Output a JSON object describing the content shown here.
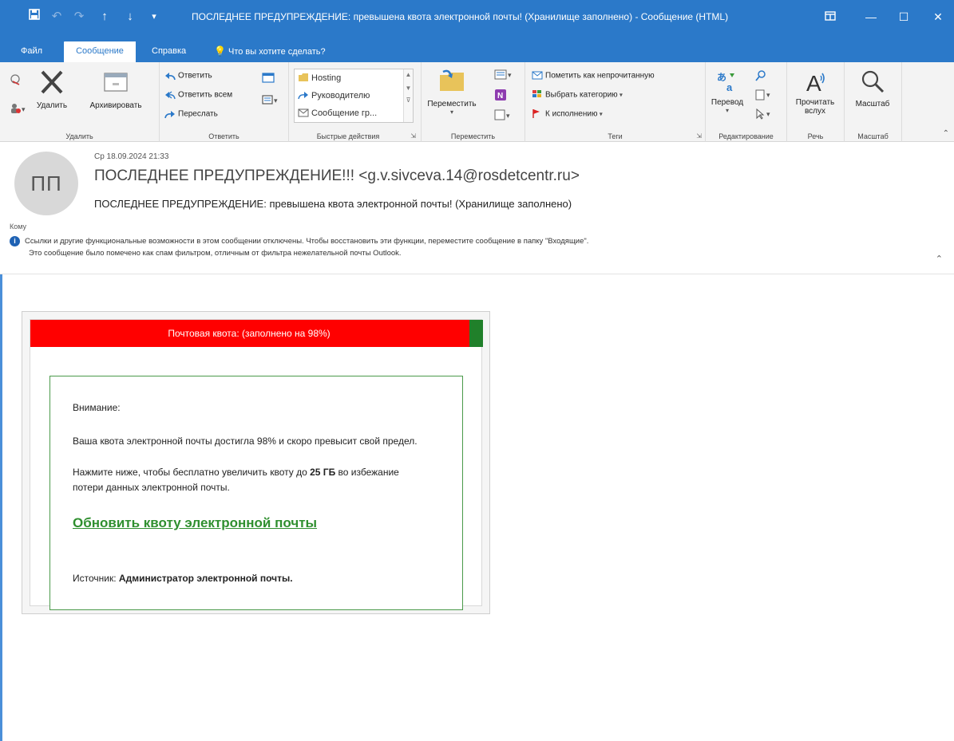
{
  "titlebar": {
    "title": "ПОСЛЕДНЕЕ ПРЕДУПРЕЖДЕНИЕ: превышена квота электронной почты! (Хранилище заполнено)  -  Сообщение (HTML)"
  },
  "menu": {
    "tabs": [
      {
        "label": "Файл"
      },
      {
        "label": "Сообщение"
      },
      {
        "label": "Справка"
      }
    ],
    "tell_me": "Что вы хотите сделать?"
  },
  "ribbon": {
    "delete_group": {
      "label": "Удалить",
      "delete": "Удалить",
      "archive": "Архивировать"
    },
    "respond_group": {
      "label": "Ответить",
      "reply": "Ответить",
      "reply_all": "Ответить всем",
      "forward": "Переслать"
    },
    "quick_steps": {
      "label": "Быстрые действия",
      "items": [
        "Hosting",
        "Руководителю",
        "Сообщение гр..."
      ]
    },
    "move_group": {
      "label": "Переместить",
      "move": "Переместить"
    },
    "tags_group": {
      "label": "Теги",
      "mark_unread": "Пометить как непрочитанную",
      "categorize": "Выбрать категорию",
      "follow_up": "К исполнению"
    },
    "editing_group": {
      "label": "Редактирование",
      "translate": "Перевод"
    },
    "speech_group": {
      "label": "Речь",
      "read_aloud_1": "Прочитать",
      "read_aloud_2": "вслух"
    },
    "zoom_group": {
      "label": "Масштаб",
      "zoom": "Масштаб"
    }
  },
  "header": {
    "avatar_initials": "ПП",
    "datetime": "Ср 18.09.2024 21:33",
    "sender": "ПОСЛЕДНЕЕ ПРЕДУПРЕЖДЕНИЕ!!! <g.v.sivceva.14@rosdetcentr.ru>",
    "subject": "ПОСЛЕДНЕЕ ПРЕДУПРЕЖДЕНИЕ: превышена квота электронной почты! (Хранилище заполнено)",
    "to_label": "Кому",
    "info_line_1": "Ссылки и другие функциональные возможности в этом сообщении отключены. Чтобы восстановить эти функции, переместите сообщение в папку \"Входящие\".",
    "info_line_2": "Это сообщение было помечено как спам фильтром, отличным от фильтра нежелательной почты Outlook."
  },
  "email": {
    "quota_text": "Почтовая квота: (заполнено на 98%)",
    "quota_percent": 97,
    "greeting": "Внимание:",
    "para1": "Ваша квота электронной почты достигла 98% и скоро превысит свой предел.",
    "para2_pre": "Нажмите ниже, чтобы бесплатно увеличить квоту до ",
    "para2_bold": "25 ГБ",
    "para2_post": " во избежание потери данных электронной почты.",
    "link_text": "Обновить квоту электронной почты",
    "source_label": "Источник: ",
    "source_value": "Администратор электронной почты."
  },
  "colors": {
    "titlebar": "#2b79c9",
    "quota_red": "#ff0000",
    "quota_green": "#20802a",
    "link_green": "#2f8f2f"
  }
}
